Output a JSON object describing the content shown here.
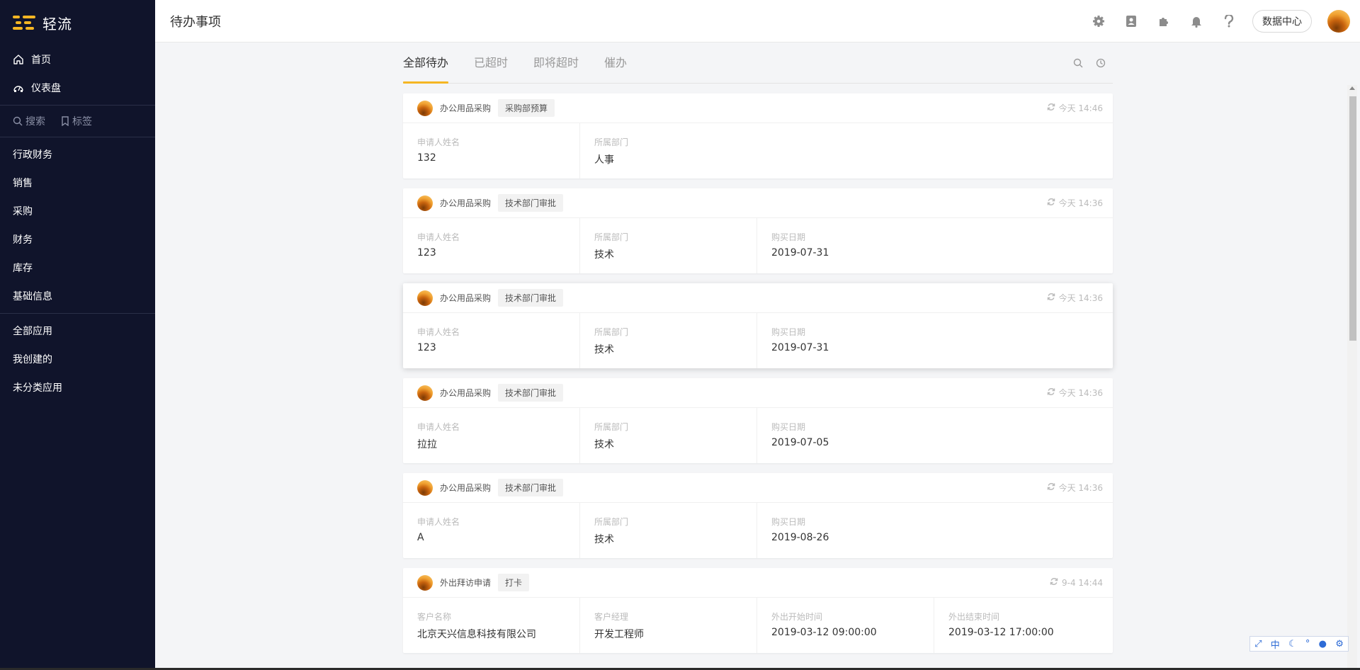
{
  "sidebar": {
    "logo_text": "轻流",
    "top_nav": [
      {
        "label": "首页",
        "icon": "home-icon"
      },
      {
        "label": "仪表盘",
        "icon": "dashboard-icon"
      }
    ],
    "search_label": "搜索",
    "tag_label": "标签",
    "groups": [
      "行政财务",
      "销售",
      "采购",
      "财务",
      "库存",
      "基础信息"
    ],
    "app_filters": [
      "全部应用",
      "我创建的",
      "未分类应用"
    ]
  },
  "header": {
    "title": "待办事项",
    "data_center_label": "数据中心",
    "icons": [
      "gear-icon",
      "contacts-icon",
      "plugin-icon",
      "bell-icon",
      "help-icon"
    ]
  },
  "tabs": [
    {
      "label": "全部待办",
      "active": true
    },
    {
      "label": "已超时",
      "active": false
    },
    {
      "label": "即将超时",
      "active": false
    },
    {
      "label": "催办",
      "active": false
    }
  ],
  "cards": [
    {
      "app": "办公用品采购",
      "stage": "采购部预算",
      "time": "今天 14:46",
      "fields": [
        {
          "label": "申请人姓名",
          "value": "132"
        },
        {
          "label": "所属部门",
          "value": "人事"
        }
      ]
    },
    {
      "app": "办公用品采购",
      "stage": "技术部门审批",
      "time": "今天 14:36",
      "fields": [
        {
          "label": "申请人姓名",
          "value": "123"
        },
        {
          "label": "所属部门",
          "value": "技术"
        },
        {
          "label": "购买日期",
          "value": "2019-07-31"
        }
      ]
    },
    {
      "app": "办公用品采购",
      "stage": "技术部门审批",
      "time": "今天 14:36",
      "fields": [
        {
          "label": "申请人姓名",
          "value": "123"
        },
        {
          "label": "所属部门",
          "value": "技术"
        },
        {
          "label": "购买日期",
          "value": "2019-07-31"
        }
      ]
    },
    {
      "app": "办公用品采购",
      "stage": "技术部门审批",
      "time": "今天 14:36",
      "fields": [
        {
          "label": "申请人姓名",
          "value": "拉拉"
        },
        {
          "label": "所属部门",
          "value": "技术"
        },
        {
          "label": "购买日期",
          "value": "2019-07-05"
        }
      ]
    },
    {
      "app": "办公用品采购",
      "stage": "技术部门审批",
      "time": "今天 14:36",
      "fields": [
        {
          "label": "申请人姓名",
          "value": "A"
        },
        {
          "label": "所属部门",
          "value": "技术"
        },
        {
          "label": "购买日期",
          "value": "2019-08-26"
        }
      ]
    },
    {
      "app": "外出拜访申请",
      "stage": "打卡",
      "time": "9-4 14:44",
      "fields": [
        {
          "label": "客户名称",
          "value": "北京天兴信息科技有限公司"
        },
        {
          "label": "客户经理",
          "value": "开发工程师"
        },
        {
          "label": "外出开始时间",
          "value": "2019-03-12 09:00:00"
        },
        {
          "label": "外出结束时间",
          "value": "2019-03-12 17:00:00"
        }
      ]
    }
  ],
  "ime_toolbar": [
    "中"
  ],
  "colors": {
    "sidebar_bg": "#10142b",
    "accent": "#f5b623"
  }
}
